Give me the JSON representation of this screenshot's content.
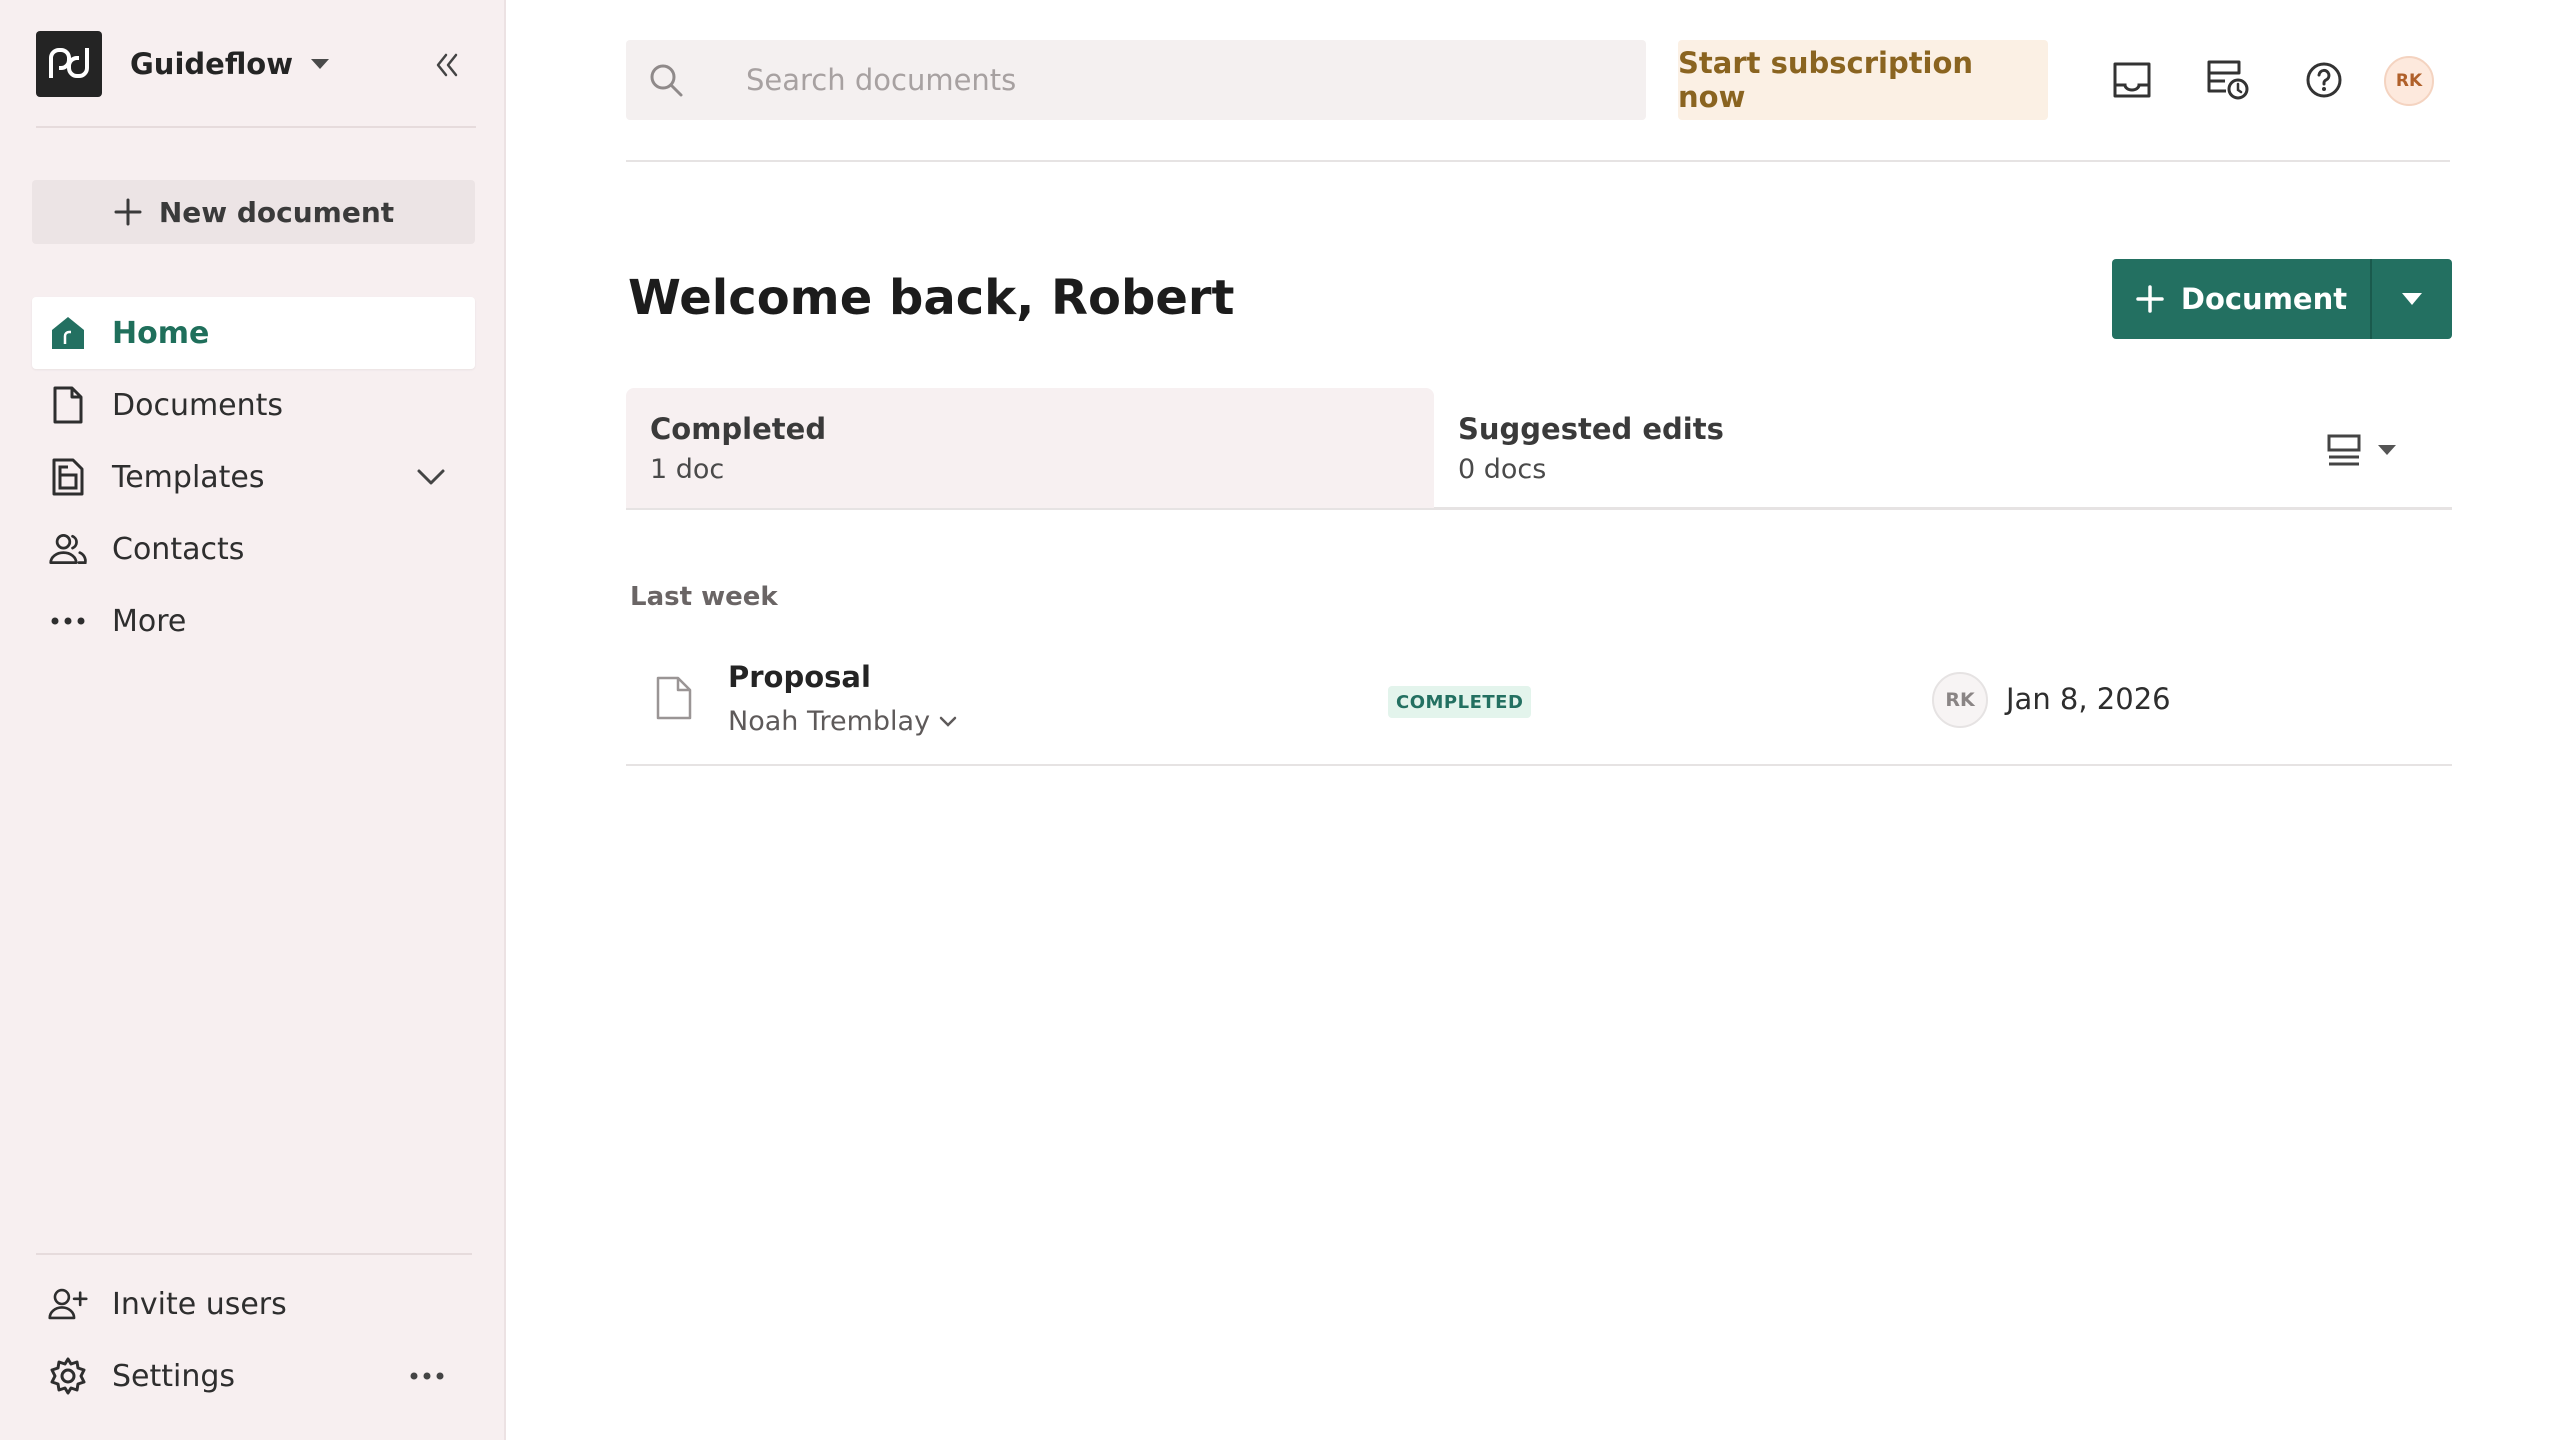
{
  "sidebar": {
    "workspace_name": "Guideflow",
    "new_document_label": "New document",
    "nav": [
      {
        "label": "Home",
        "icon": "home-icon"
      },
      {
        "label": "Documents",
        "icon": "document-icon"
      },
      {
        "label": "Templates",
        "icon": "template-icon"
      },
      {
        "label": "Contacts",
        "icon": "contacts-icon"
      },
      {
        "label": "More",
        "icon": "more-dots-icon"
      }
    ],
    "bottom": [
      {
        "label": "Invite users",
        "icon": "invite-user-icon"
      },
      {
        "label": "Settings",
        "icon": "gear-icon"
      }
    ]
  },
  "topbar": {
    "search_placeholder": "Search documents",
    "subscribe_label": "Start subscription now",
    "user_initials": "RK"
  },
  "main": {
    "welcome": "Welcome back, Robert",
    "document_button_label": "Document",
    "tabs": [
      {
        "title": "Completed",
        "count": "1 doc"
      },
      {
        "title": "Suggested edits",
        "count": "0 docs"
      }
    ],
    "section_label": "Last week",
    "documents": [
      {
        "title": "Proposal",
        "owner": "Noah Tremblay",
        "status": "COMPLETED",
        "assignee_initials": "RK",
        "date": "Jan 8, 2026"
      }
    ]
  },
  "colors": {
    "accent": "#237061",
    "sidebar_bg": "#f7eff0",
    "subscribe_text": "#8a6420"
  }
}
